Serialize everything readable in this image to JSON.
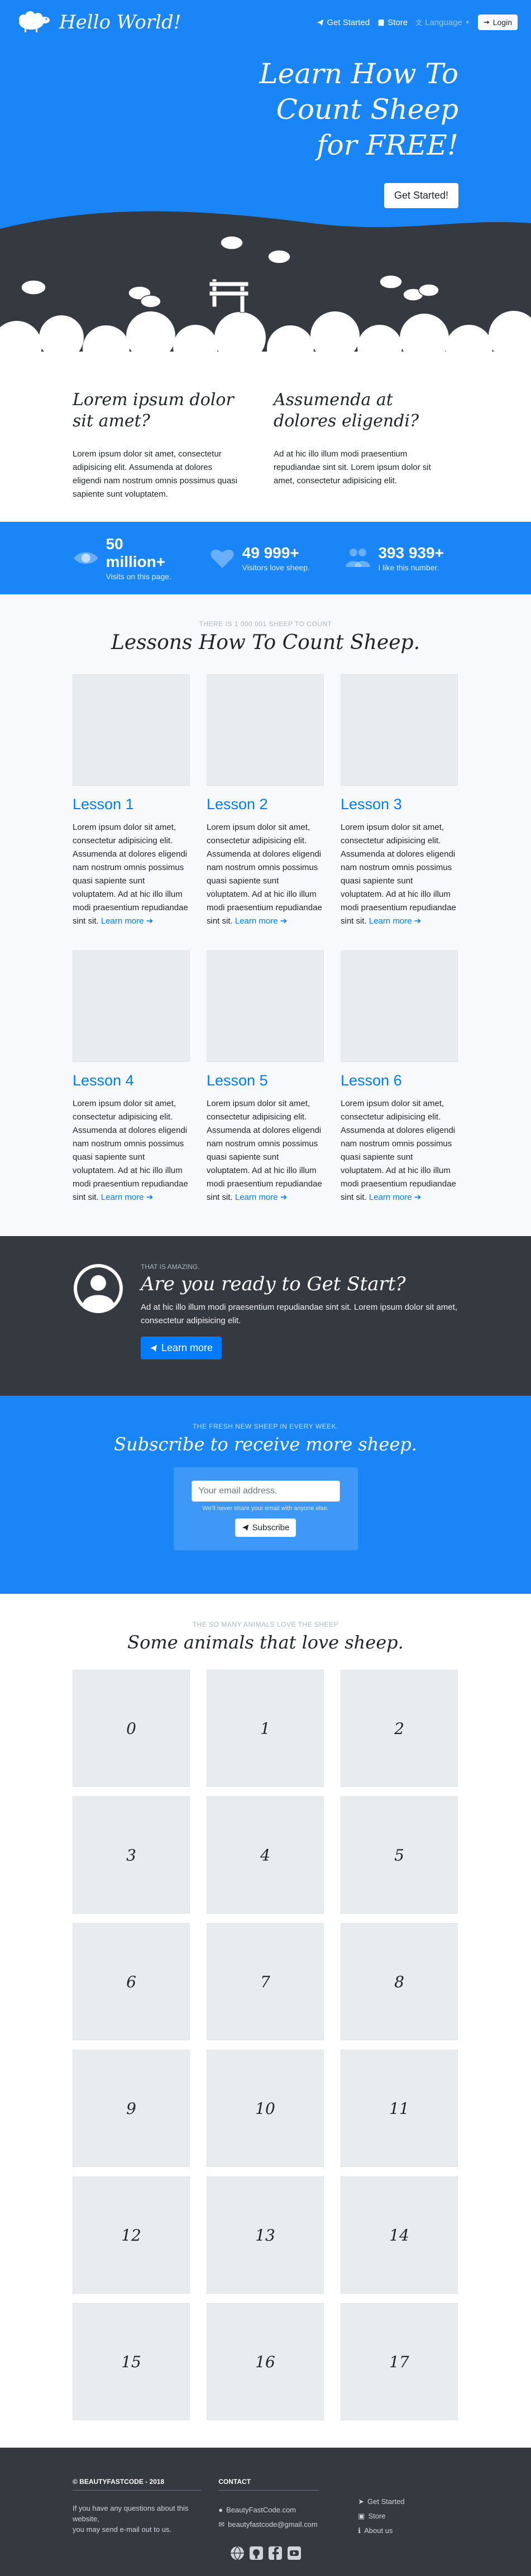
{
  "nav": {
    "brand": "Hello World!",
    "links": [
      "Get Started",
      "Store"
    ],
    "language": "Language",
    "login": "Login"
  },
  "hero": {
    "title_lines": [
      "Learn How To",
      "Count Sheep",
      "for FREE!"
    ],
    "cta": "Get Started!"
  },
  "features": [
    {
      "title": "Lorem ipsum dolor sit amet?",
      "text": "Lorem ipsum dolor sit amet, consectetur adipisicing elit. Assumenda at dolores eligendi nam nostrum omnis possimus quasi sapiente sunt voluptatem."
    },
    {
      "title": "Assumenda at dolores eligendi?",
      "text": "Ad at hic illo illum modi praesentium repudiandae sint sit. Lorem ipsum dolor sit amet, consectetur adipisicing elit."
    }
  ],
  "stats": [
    {
      "icon": "eye-icon",
      "value": "50 million+",
      "label": "Visits on this page."
    },
    {
      "icon": "heart-icon",
      "value": "49 999+",
      "label": "Visitors love sheep."
    },
    {
      "icon": "users-icon",
      "value": "393 939+",
      "label": "I like this number."
    }
  ],
  "lessons": {
    "eyebrow": "THERE IS 1 000 001 SHEEP TO COUNT",
    "title": "Lessons How To Count Sheep.",
    "items": [
      {
        "title": "Lesson 1",
        "text": "Lorem ipsum dolor sit amet, consectetur adipisicing elit. Assumenda at dolores eligendi nam nostrum omnis possimus quasi sapiente sunt voluptatem. Ad at hic illo illum modi praesentium repudiandae sint sit.",
        "link": "Learn more"
      },
      {
        "title": "Lesson 2",
        "text": "Lorem ipsum dolor sit amet, consectetur adipisicing elit. Assumenda at dolores eligendi nam nostrum omnis possimus quasi sapiente sunt voluptatem. Ad at hic illo illum modi praesentium repudiandae sint sit.",
        "link": "Learn more"
      },
      {
        "title": "Lesson 3",
        "text": "Lorem ipsum dolor sit amet, consectetur adipisicing elit. Assumenda at dolores eligendi nam nostrum omnis possimus quasi sapiente sunt voluptatem. Ad at hic illo illum modi praesentium repudiandae sint sit.",
        "link": "Learn more"
      },
      {
        "title": "Lesson 4",
        "text": "Lorem ipsum dolor sit amet, consectetur adipisicing elit. Assumenda at dolores eligendi nam nostrum omnis possimus quasi sapiente sunt voluptatem. Ad at hic illo illum modi praesentium repudiandae sint sit.",
        "link": "Learn more"
      },
      {
        "title": "Lesson 5",
        "text": "Lorem ipsum dolor sit amet, consectetur adipisicing elit. Assumenda at dolores eligendi nam nostrum omnis possimus quasi sapiente sunt voluptatem. Ad at hic illo illum modi praesentium repudiandae sint sit.",
        "link": "Learn more"
      },
      {
        "title": "Lesson 6",
        "text": "Lorem ipsum dolor sit amet, consectetur adipisicing elit. Assumenda at dolores eligendi nam nostrum omnis possimus quasi sapiente sunt voluptatem. Ad at hic illo illum modi praesentium repudiandae sint sit.",
        "link": "Learn more"
      }
    ]
  },
  "cta": {
    "eyebrow": "THAT IS AMAZING.",
    "title": "Are you ready to Get Start?",
    "text": "Ad at hic illo illum modi praesentium repudiandae sint sit. Lorem ipsum dolor sit amet, consectetur adipisicing elit.",
    "button": "Learn more"
  },
  "subscribe": {
    "eyebrow": "THE FRESH NEW SHEEP IN EVERY WEEK.",
    "title": "Subscribe to receive more sheep.",
    "placeholder": "Your email address.",
    "help": "We'll never share your email with anyone else.",
    "button": "Subscribe"
  },
  "animals": {
    "eyebrow": "THE SO MANY ANIMALS LOVE THE SHEEP",
    "title": "Some animals that love sheep.",
    "tiles": [
      "0",
      "1",
      "2",
      "3",
      "4",
      "5",
      "6",
      "7",
      "8",
      "9",
      "10",
      "11",
      "12",
      "13",
      "14",
      "15",
      "16",
      "17"
    ]
  },
  "footer": {
    "copyright": "© BEAUTYFASTCODE - 2018",
    "about_lines": [
      "If you have any questions about this website,",
      "you may send e-mail out to us."
    ],
    "contact_head": "CONTACT",
    "contact": [
      "BeautyFastCode.com",
      "beautyfastcode@gmail.com"
    ],
    "links": [
      "Get Started",
      "Store",
      "About us"
    ],
    "socials": [
      "globe-icon",
      "github-icon",
      "facebook-icon",
      "youtube-icon"
    ]
  },
  "colors": {
    "primary": "#1a85f7",
    "dark": "#343a40",
    "link": "#007bff"
  }
}
